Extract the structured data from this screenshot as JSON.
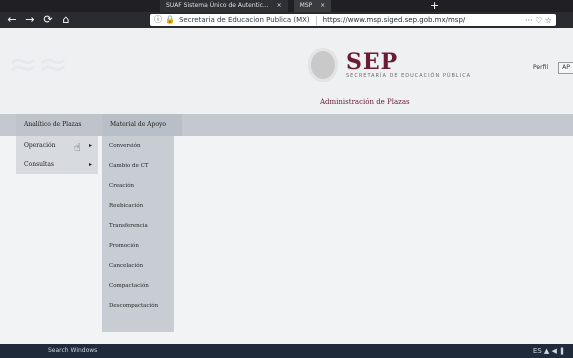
{
  "browser": {
    "tabs": [
      {
        "label": "SUAF Sistema Único de Autentic...",
        "active": false
      },
      {
        "label": "MSP",
        "active": true
      }
    ],
    "new_tab": "+",
    "url_site": "Secretaria de Educacion Publica (MX)",
    "url_path": "https://www.msp.siged.sep.gob.mx/msp/",
    "url_actions": "··· ♡ ☆"
  },
  "header": {
    "logo_text": "SEP",
    "logo_sub": "SECRETARÍA DE EDUCACIÓN PÚBLICA",
    "admin_title": "Administración de Plazas",
    "profile_label": "Perfil",
    "profile_button": "AP"
  },
  "menubar": {
    "items": [
      {
        "label": "Analítico de Plazas"
      },
      {
        "label": "Material de Apoyo"
      }
    ]
  },
  "leftmenu": {
    "items": [
      {
        "label": "Operación"
      },
      {
        "label": "Consultas"
      }
    ]
  },
  "dropdown": {
    "items": [
      {
        "label": "Conversión"
      },
      {
        "label": "Cambio de CT"
      },
      {
        "label": "Creación"
      },
      {
        "label": "Reubicación"
      },
      {
        "label": "Transferencia"
      },
      {
        "label": "Promoción"
      },
      {
        "label": "Cancelación"
      },
      {
        "label": "Compactación"
      },
      {
        "label": "Descompactación"
      }
    ]
  },
  "taskbar": {
    "left_text": "Search Windows",
    "right_text": "ES ▲ ◀ ❚"
  },
  "colors": {
    "brand": "#691c32",
    "menubar": "#c4c9cf",
    "dropdown": "#c8cdd3"
  }
}
